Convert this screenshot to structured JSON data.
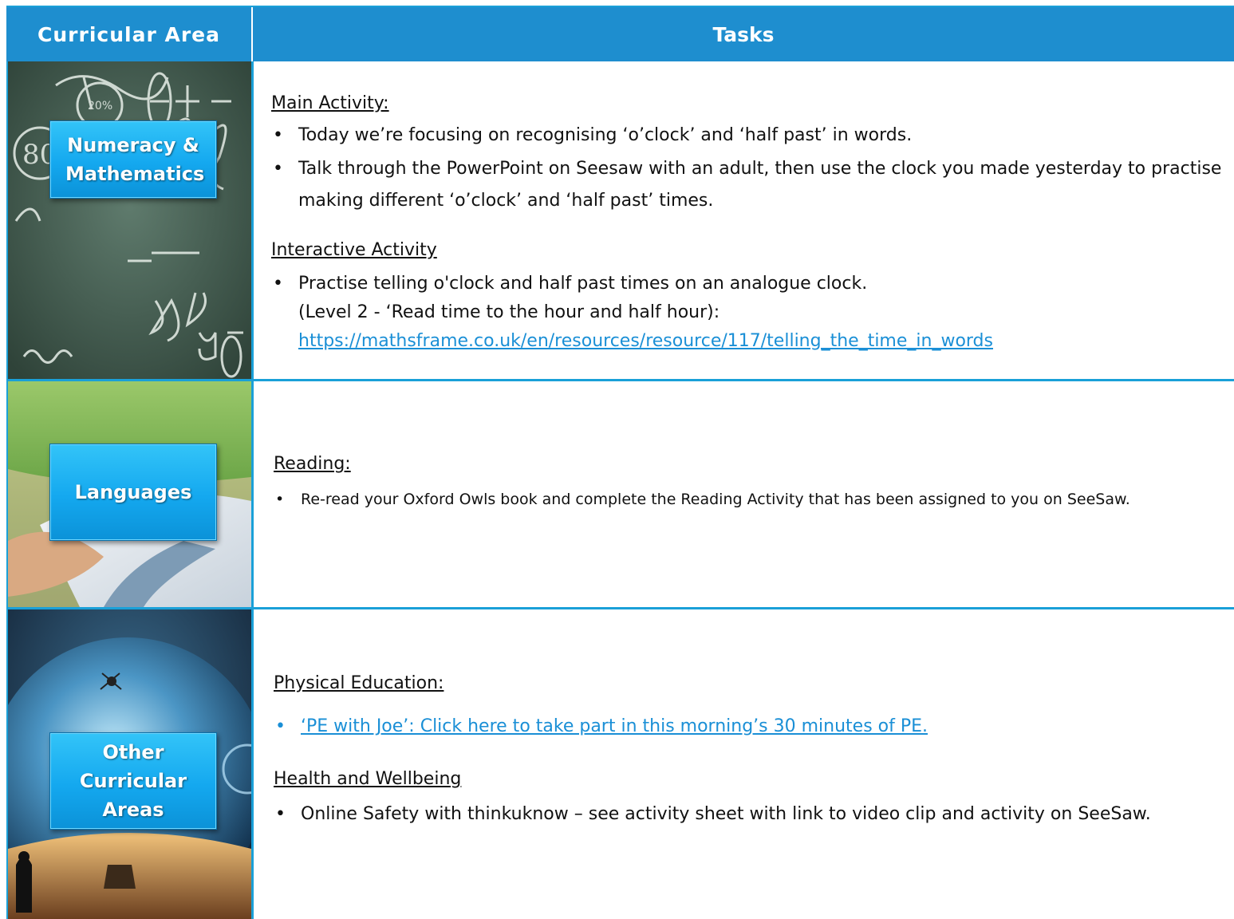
{
  "header": {
    "col1": "Curricular Area",
    "col2": "Tasks"
  },
  "rows": [
    {
      "area": "Numeracy & Mathematics",
      "icons": [
        "chalkboard-image"
      ],
      "sections": [
        {
          "heading": "Main Activity:",
          "bullets": [
            "Today we’re focusing on recognising ‘o’clock’ and ‘half past’ in words.",
            "Talk through the PowerPoint on Seesaw with an adult, then use the clock you made yesterday to practise making different ‘o’clock’ and ‘half past’ times."
          ]
        },
        {
          "heading": "Interactive Activity",
          "bullet_lines": [
            "Practise telling o'clock and half past times on an analogue clock.",
            "(Level 2 - ‘Read time to the hour and half hour):"
          ],
          "link": "https://mathsframe.co.uk/en/resources/resource/117/telling_the_time_in_words"
        }
      ]
    },
    {
      "area": "Languages",
      "icons": [
        "reading-image"
      ],
      "sections": [
        {
          "heading": "Reading:",
          "bullets": [
            "Re-read your Oxford Owls book and complete the Reading Activity that has been assigned to you on SeeSaw."
          ]
        }
      ]
    },
    {
      "area": "Other Curricular Areas",
      "icons": [
        "globe-image"
      ],
      "sections": [
        {
          "heading": "Physical Education:",
          "link": "‘PE with Joe’: Click here to take part in this morning’s 30 minutes of PE."
        },
        {
          "heading": "Health and Wellbeing",
          "bullets": [
            "Online Safety with thinkuknow –  see activity sheet with link to video clip and activity on SeeSaw."
          ]
        }
      ]
    }
  ],
  "colors": {
    "header_bg": "#1e8ecf",
    "border": "#1aa0d8",
    "label_bg": "#14a8ef",
    "link": "#1a8fd6"
  }
}
